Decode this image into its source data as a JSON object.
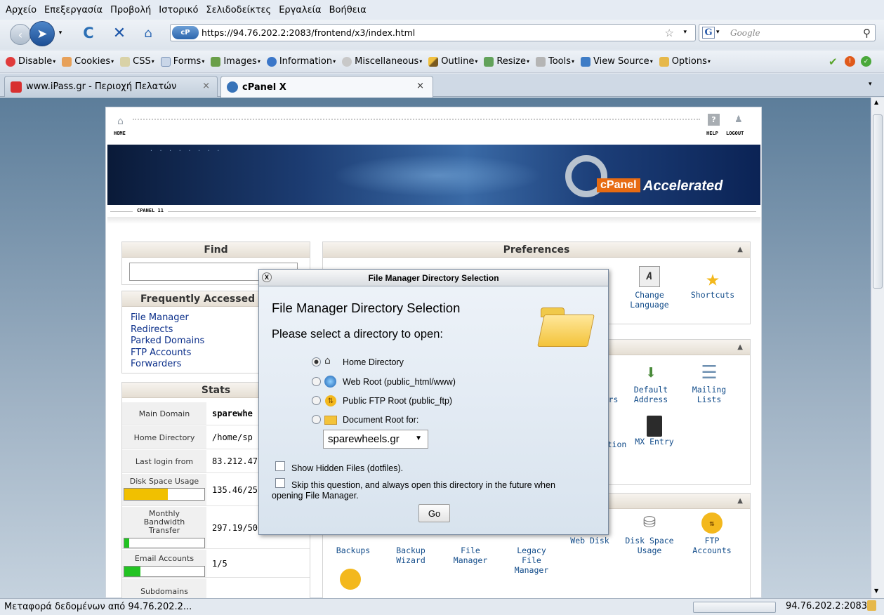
{
  "browser": {
    "menu": [
      "Αρχείο",
      "Επεξεργασία",
      "Προβολή",
      "Ιστορικό",
      "Σελιδοδείκτες",
      "Εργαλεία",
      "Βοήθεια"
    ],
    "url": "https://94.76.202.2:2083/frontend/x3/index.html",
    "search_placeholder": "Google",
    "webdev": [
      "Disable",
      "Cookies",
      "CSS",
      "Forms",
      "Images",
      "Information",
      "Miscellaneous",
      "Outline",
      "Resize",
      "Tools",
      "View Source",
      "Options"
    ],
    "tabs": [
      {
        "label": "www.iPass.gr - Περιοχή Πελατών",
        "close": "×"
      },
      {
        "label": "cPanel X",
        "close": "×"
      }
    ],
    "status_text": "Μεταφορά δεδομένων από 94.76.202.2...",
    "status_host": "94.76.202.2:2083"
  },
  "cpanel": {
    "nav": {
      "home": "HOME",
      "help": "HELP",
      "logout": "LOGOUT"
    },
    "brand": "cPanel",
    "brand_tag": "Accelerated",
    "version": "CPANEL 11",
    "find_title": "Find",
    "freq_title": "Frequently Accessed",
    "freq_links": [
      "File Manager",
      "Redirects",
      "Parked Domains",
      "FTP Accounts",
      "Forwarders"
    ],
    "stats_title": "Stats",
    "stats": [
      {
        "label": "Main Domain",
        "value": "sparewhe"
      },
      {
        "label": "Home Directory",
        "value": "/home/sp"
      },
      {
        "label": "Last login from",
        "value": "83.212.47"
      },
      {
        "label": "Disk Space Usage",
        "value": "135.46/25",
        "fill": 0.54
      },
      {
        "label": "Monthly Bandwidth Transfer",
        "value": "297.19/50",
        "fill": 0.06
      },
      {
        "label": "Email Accounts",
        "value": "1/5",
        "fill": 0.2
      },
      {
        "label": "Subdomains",
        "value": ""
      }
    ],
    "preferences_title": "Preferences",
    "pref_icons": [
      {
        "label": "Change Language"
      },
      {
        "label": "Shortcuts"
      }
    ],
    "mail_icons": [
      {
        "label": "Default Address"
      },
      {
        "label": "Mailing Lists"
      },
      {
        "label": "MX Entry"
      },
      {
        "label": "ers"
      },
      {
        "label": "ation"
      }
    ],
    "files_icons": [
      {
        "label": "Backups"
      },
      {
        "label": "Backup Wizard"
      },
      {
        "label": "File Manager"
      },
      {
        "label": "Legacy File Manager"
      },
      {
        "label": "Web Disk"
      },
      {
        "label": "Disk Space Usage"
      },
      {
        "label": "FTP Accounts"
      }
    ]
  },
  "dialog": {
    "titlebar": "File Manager Directory Selection",
    "close": "X",
    "heading": "File Manager Directory Selection",
    "prompt": "Please select a directory to open:",
    "options": [
      "Home Directory",
      "Web Root (public_html/www)",
      "Public FTP Root (public_ftp)",
      "Document Root for:"
    ],
    "selected_option": 0,
    "domain_select": "sparewheels.gr",
    "show_hidden": "Show Hidden Files (dotfiles).",
    "skip_line1": "Skip this question, and always open this directory in the future when",
    "skip_line2": "opening File Manager.",
    "go": "Go"
  }
}
